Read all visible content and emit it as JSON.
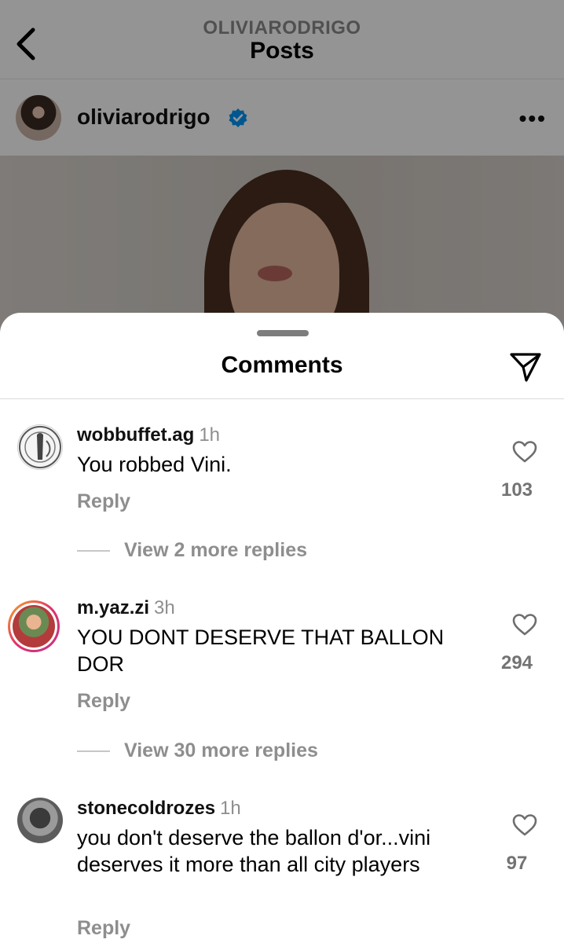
{
  "header": {
    "username": "OLIVIARODRIGO",
    "title": "Posts"
  },
  "post": {
    "username": "oliviarodrigo",
    "more": "•••",
    "verified": true
  },
  "comments_sheet": {
    "title": "Comments",
    "comments": [
      {
        "username": "wobbuffet.ag",
        "time": "1h",
        "text": "You robbed Vini.",
        "reply_label": "Reply",
        "likes": "103",
        "view_replies": "View 2 more replies"
      },
      {
        "username": "m.yaz.zi",
        "time": "3h",
        "text": "YOU DONT DESERVE THAT BALLON DOR",
        "reply_label": "Reply",
        "likes": "294",
        "view_replies": "View 30 more replies"
      },
      {
        "username": "stonecoldrozes",
        "time": "1h",
        "text": "you don't deserve the ballon d'or...vini deserves it more than all city players",
        "reply_label": "Reply",
        "likes": "97"
      }
    ]
  },
  "icons": {
    "back": "chevron-left-icon",
    "verified": "verified-badge-icon",
    "share": "paper-plane-icon",
    "like": "heart-outline-icon"
  },
  "colors": {
    "verified_blue": "#0095f6",
    "secondary_text": "#8e8e8e",
    "story_ring_start": "#f9a825",
    "story_ring_end": "#c13584"
  }
}
